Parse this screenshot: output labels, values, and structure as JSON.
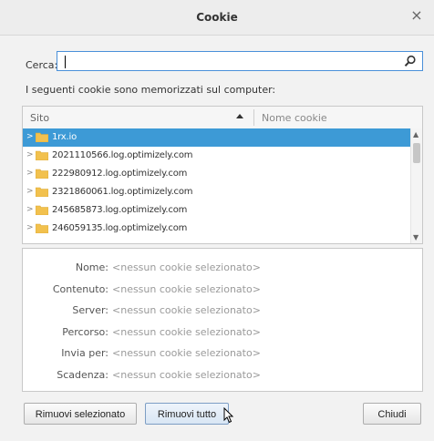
{
  "window": {
    "title": "Cookie",
    "close_glyph": "×"
  },
  "search": {
    "label": "Cerca:",
    "value": "",
    "placeholder": "",
    "icon": "search-icon"
  },
  "stored_text": "I seguenti cookie sono memorizzati sul computer:",
  "tree": {
    "columns": {
      "site": "Sito",
      "cookie_name": "Nome cookie",
      "sort": "ascending"
    },
    "rows": [
      {
        "host": "1rx.io",
        "selected": true
      },
      {
        "host": "2021110566.log.optimizely.com",
        "selected": false
      },
      {
        "host": "222980912.log.optimizely.com",
        "selected": false
      },
      {
        "host": "2321860061.log.optimizely.com",
        "selected": false
      },
      {
        "host": "245685873.log.optimizely.com",
        "selected": false
      },
      {
        "host": "246059135.log.optimizely.com",
        "selected": false
      }
    ]
  },
  "details": [
    {
      "label": "Nome:",
      "value": "<nessun cookie selezionato>"
    },
    {
      "label": "Contenuto:",
      "value": "<nessun cookie selezionato>"
    },
    {
      "label": "Server:",
      "value": "<nessun cookie selezionato>"
    },
    {
      "label": "Percorso:",
      "value": "<nessun cookie selezionato>"
    },
    {
      "label": "Invia per:",
      "value": "<nessun cookie selezionato>"
    },
    {
      "label": "Scadenza:",
      "value": "<nessun cookie selezionato>"
    }
  ],
  "buttons": {
    "remove_selected": "Rimuovi selezionato",
    "remove_all": "Rimuovi tutto",
    "close": "Chiudi"
  },
  "colors": {
    "selection": "#3d9ad6",
    "search_border": "#4a90d9",
    "folder": "#f2c14e"
  }
}
